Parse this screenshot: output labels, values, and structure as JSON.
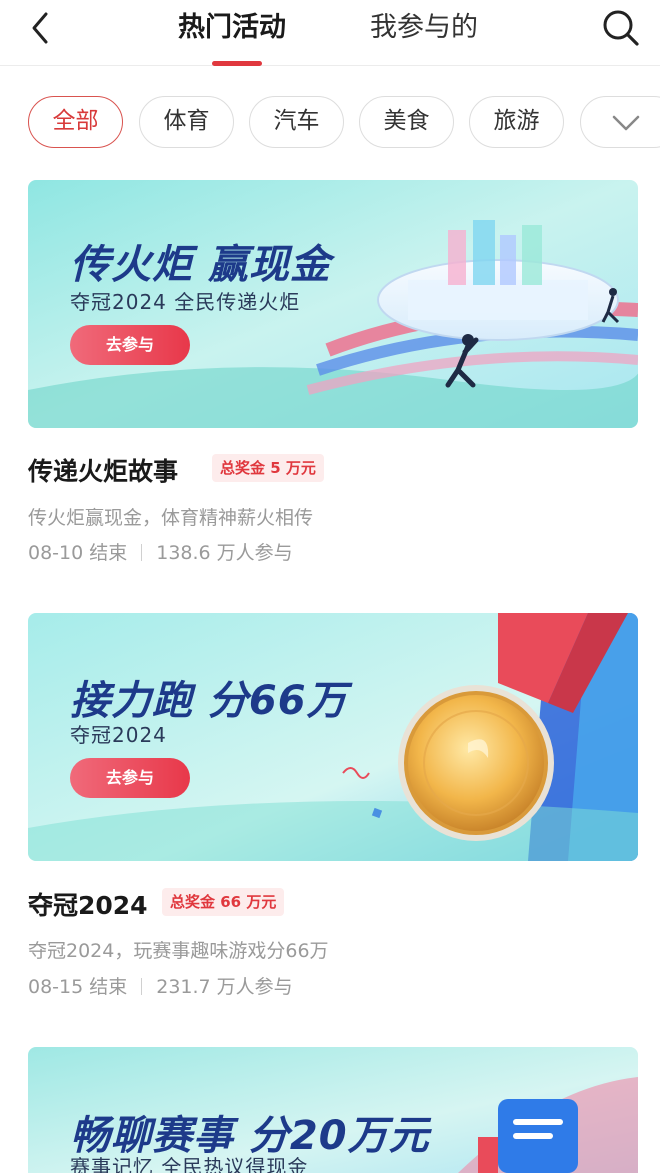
{
  "header": {
    "tabs": [
      {
        "label": "热门活动",
        "active": true
      },
      {
        "label": "我参与的",
        "active": false
      }
    ]
  },
  "categories": {
    "items": [
      {
        "label": "全部",
        "active": true
      },
      {
        "label": "体育",
        "active": false
      },
      {
        "label": "汽车",
        "active": false
      },
      {
        "label": "美食",
        "active": false
      },
      {
        "label": "旅游",
        "active": false
      }
    ]
  },
  "activities": [
    {
      "banner_title": "传火炬 赢现金",
      "banner_subtitle": "夺冠2024 全民传递火炬",
      "banner_button": "去参与",
      "title": "传递火炬故事",
      "prize": "总奖金 5 万元",
      "desc": "传火炬赢现金，体育精神薪火相传",
      "end": "08-10 结束",
      "participants": "138.6 万人参与"
    },
    {
      "banner_title": "接力跑 分66万",
      "banner_subtitle": "夺冠2024",
      "banner_button": "去参与",
      "title": "夺冠2024",
      "prize": "总奖金 66 万元",
      "desc": "夺冠2024，玩赛事趣味游戏分66万",
      "end": "08-15 结束",
      "participants": "231.7 万人参与"
    },
    {
      "banner_title": "畅聊赛事 分20万元",
      "banner_subtitle": "赛事记忆 全民热议得现金"
    }
  ],
  "colors": {
    "accent": "#e0383e",
    "banner_title": "#1d3a8a"
  }
}
